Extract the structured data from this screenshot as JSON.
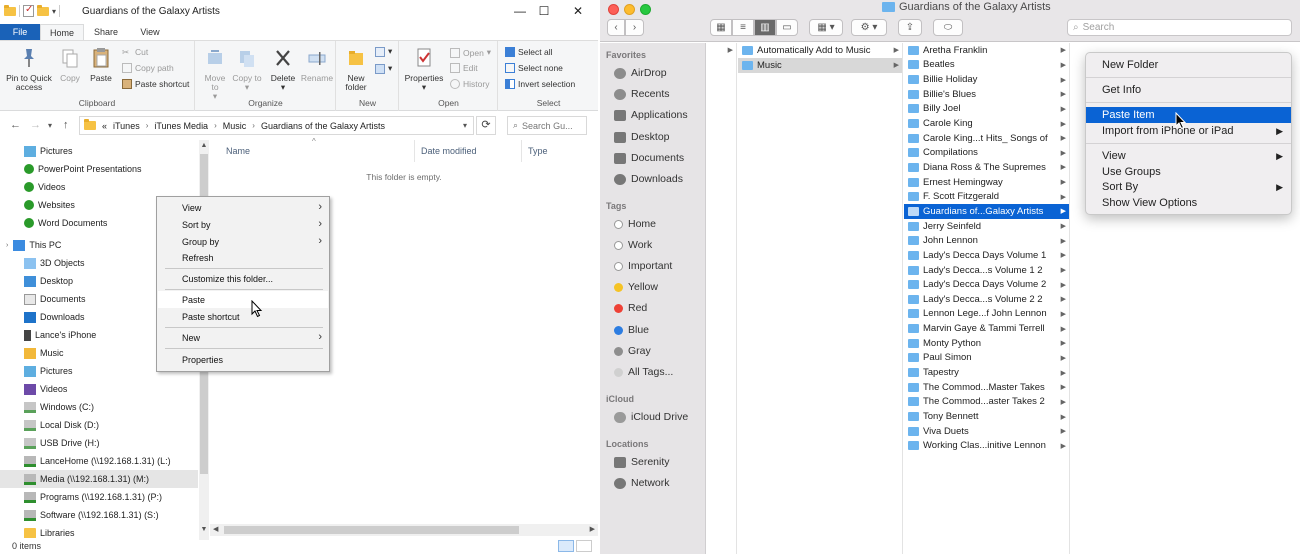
{
  "win": {
    "title": "Guardians of the Galaxy Artists",
    "tabs": [
      "File",
      "Home",
      "Share",
      "View"
    ],
    "ribbon": {
      "clipboard": {
        "label": "Clipboard",
        "pin": "Pin to Quick access",
        "copy": "Copy",
        "paste": "Paste",
        "cut": "Cut",
        "copy_path": "Copy path",
        "paste_shortcut": "Paste shortcut"
      },
      "organize": {
        "label": "Organize",
        "move_to": "Move to",
        "copy_to": "Copy to",
        "delete": "Delete",
        "rename": "Rename"
      },
      "new": {
        "label": "New",
        "new_folder": "New folder"
      },
      "open": {
        "label": "Open",
        "properties": "Properties",
        "open": "Open",
        "edit": "Edit",
        "history": "History"
      },
      "select": {
        "label": "Select",
        "select_all": "Select all",
        "select_none": "Select none",
        "invert": "Invert selection"
      }
    },
    "address": {
      "prefix": "«",
      "crumbs": [
        "iTunes",
        "iTunes Media",
        "Music",
        "Guardians of the Galaxy Artists"
      ],
      "search_placeholder": "Search Gu..."
    },
    "nav": [
      "Pictures",
      "PowerPoint Presentations",
      "Videos",
      "Websites",
      "Word Documents",
      "This PC",
      "3D Objects",
      "Desktop",
      "Documents",
      "Downloads",
      "Lance's iPhone",
      "Music",
      "Pictures",
      "Videos",
      "Windows (C:)",
      "Local Disk (D:)",
      "USB Drive (H:)",
      "LanceHome (\\\\192.168.1.31) (L:)",
      "Media (\\\\192.168.1.31) (M:)",
      "Programs (\\\\192.168.1.31) (P:)",
      "Software (\\\\192.168.1.31) (S:)",
      "Libraries"
    ],
    "columns": [
      "Name",
      "Date modified",
      "Type"
    ],
    "empty": "This folder is empty.",
    "status": "0 items",
    "context_menu": [
      "View",
      "Sort by",
      "Group by",
      "Refresh",
      "Customize this folder...",
      "Paste",
      "Paste shortcut",
      "New",
      "Properties"
    ]
  },
  "mac": {
    "title": "Guardians of the Galaxy Artists",
    "search_placeholder": "Search",
    "sidebar": {
      "favorites_h": "Favorites",
      "favorites": [
        "AirDrop",
        "Recents",
        "Applications",
        "Desktop",
        "Documents",
        "Downloads"
      ],
      "tags_h": "Tags",
      "tags": [
        {
          "name": "Home",
          "color": "#ffffff"
        },
        {
          "name": "Work",
          "color": "#ffffff"
        },
        {
          "name": "Important",
          "color": "#ffffff"
        },
        {
          "name": "Yellow",
          "color": "#f5c325"
        },
        {
          "name": "Red",
          "color": "#ee4136"
        },
        {
          "name": "Blue",
          "color": "#2d7de1"
        },
        {
          "name": "Gray",
          "color": "#8e8e8e"
        },
        {
          "name": "All Tags...",
          "color": "#d0d0d0"
        }
      ],
      "icloud_h": "iCloud",
      "icloud": [
        "iCloud Drive"
      ],
      "locations_h": "Locations",
      "locations": [
        "Serenity",
        "Network"
      ]
    },
    "col1": [
      "Automatically Add to Music",
      "Music"
    ],
    "col2": [
      "Aretha Franklin",
      "Beatles",
      "Billie Holiday",
      "Billie's Blues",
      "Billy Joel",
      "Carole King",
      "Carole King...t Hits_ Songs of",
      "Compilations",
      "Diana Ross & The Supremes",
      "Ernest Hemingway",
      "F. Scott Fitzgerald",
      "Guardians of...Galaxy Artists",
      "Jerry Seinfeld",
      "John Lennon",
      "Lady's Decca Days Volume 1",
      "Lady's Decca...s Volume 1 2",
      "Lady's Decca Days Volume 2",
      "Lady's Decca...s Volume 2 2",
      "Lennon Lege...f John Lennon",
      "Marvin Gaye & Tammi Terrell",
      "Monty Python",
      "Paul Simon",
      "Tapestry",
      "The Commod...Master Takes",
      "The Commod...aster Takes 2",
      "Tony Bennett",
      "Viva Duets",
      "Working Clas...initive Lennon"
    ],
    "context_menu": [
      "New Folder",
      "Get Info",
      "Paste Item",
      "Import from iPhone or iPad",
      "View",
      "Use Groups",
      "Sort By",
      "Show View Options"
    ]
  }
}
